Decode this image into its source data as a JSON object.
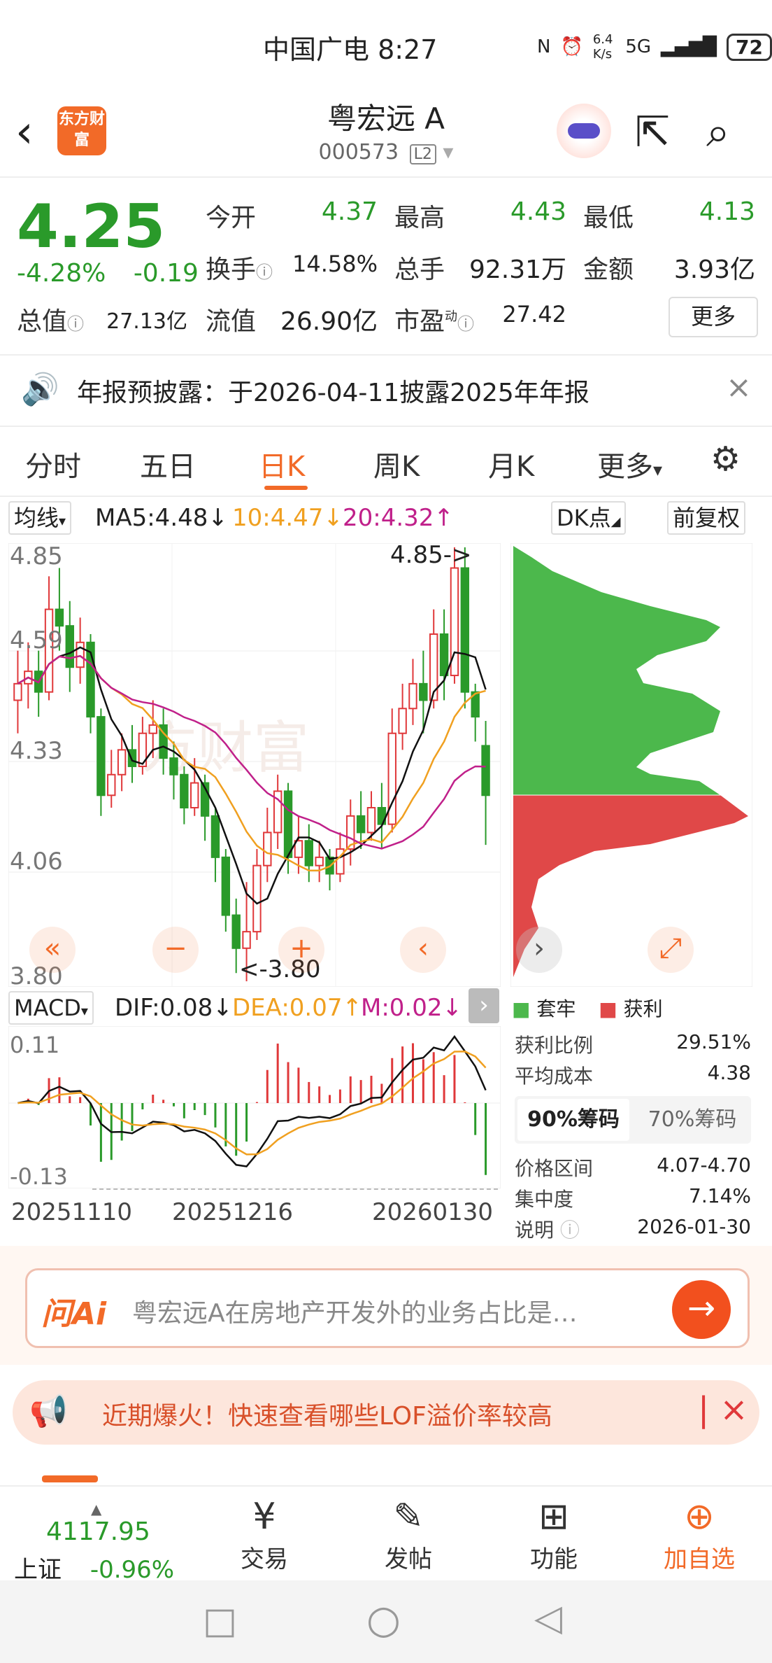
{
  "status_bar": {
    "carrier_time": "中国广电 8:27",
    "net_speed": "6.4 K/s",
    "signal": "5G",
    "battery": "72"
  },
  "header": {
    "logo_text": "东方财富",
    "stock_name": "粤宏远 A",
    "stock_code": "000573",
    "level_badge": "L2"
  },
  "quote": {
    "price": "4.25",
    "change_pct": "-4.28%",
    "change_amt": "-0.19",
    "open_label": "今开",
    "open": "4.37",
    "high_label": "最高",
    "high": "4.43",
    "low_label": "最低",
    "low": "4.13",
    "turnover_label": "换手",
    "turnover": "14.58%",
    "volume_label": "总手",
    "volume": "92.31万",
    "amount_label": "金额",
    "amount": "3.93亿",
    "total_cap_label": "总值",
    "total_cap": "27.13亿",
    "float_cap_label": "流值",
    "float_cap": "26.90亿",
    "pe_label": "市盈",
    "pe_sup": "动",
    "pe": "27.42",
    "more_label": "更多"
  },
  "notice": {
    "text": "年报预披露：于2026-04-11披露2025年年报"
  },
  "tabs": [
    "分时",
    "五日",
    "日K",
    "周K",
    "月K",
    "更多"
  ],
  "ma_row": {
    "selector": "均线",
    "ma5": "MA5:4.48↓",
    "ma10": "10:4.47↓",
    "ma20": "20:4.32↑",
    "dk": "DK点",
    "adjust": "前复权"
  },
  "kchart": {
    "y_labels": [
      "4.85",
      "4.59",
      "4.33",
      "4.06",
      "3.80"
    ],
    "max_marker": "4.85->",
    "min_marker": "<-3.80"
  },
  "macd_row": {
    "selector": "MACD",
    "dif": "DIF:0.08↓",
    "dea": "DEA:0.07↑",
    "m": "M:0.02↓",
    "y_top": "0.11",
    "y_bottom": "-0.13"
  },
  "x_labels": [
    "20251110",
    "20251216",
    "20260130"
  ],
  "chip": {
    "legend_trapped": "套牢",
    "legend_profit": "获利",
    "rows": [
      {
        "label": "获利比例",
        "value": "29.51%"
      },
      {
        "label": "平均成本",
        "value": "4.38"
      }
    ],
    "tab_90": "90%筹码",
    "tab_70": "70%筹码",
    "rows2": [
      {
        "label": "价格区间",
        "value": "4.07-4.70"
      },
      {
        "label": "集中度",
        "value": "7.14%"
      },
      {
        "label": "说明",
        "value": "2026-01-30"
      }
    ]
  },
  "ai": {
    "badge": "问Ai",
    "placeholder": "粤宏远A在房地产开发外的业务占比是…"
  },
  "promo": {
    "text": "近期爆火！快速查看哪些LOF溢价率较高"
  },
  "bottom_nav": {
    "index_value": "4117.95",
    "index_name": "上证",
    "index_change": "-0.96%",
    "items": [
      "交易",
      "发帖",
      "功能",
      "加自选"
    ]
  },
  "colors": {
    "accent": "#f26a28",
    "up": "#e0383a",
    "down": "#2a9a2a",
    "ma10": "#f0a020",
    "ma20": "#c0208a"
  },
  "chart_data": {
    "type": "candlestick",
    "y_range": [
      3.8,
      4.85
    ],
    "candles": [
      {
        "o": 4.48,
        "c": 4.52,
        "h": 4.6,
        "l": 4.4
      },
      {
        "o": 4.52,
        "c": 4.55,
        "h": 4.62,
        "l": 4.46
      },
      {
        "o": 4.55,
        "c": 4.5,
        "h": 4.6,
        "l": 4.44
      },
      {
        "o": 4.5,
        "c": 4.7,
        "h": 4.78,
        "l": 4.48
      },
      {
        "o": 4.7,
        "c": 4.66,
        "h": 4.8,
        "l": 4.6
      },
      {
        "o": 4.66,
        "c": 4.56,
        "h": 4.72,
        "l": 4.5
      },
      {
        "o": 4.56,
        "c": 4.62,
        "h": 4.68,
        "l": 4.52
      },
      {
        "o": 4.62,
        "c": 4.44,
        "h": 4.64,
        "l": 4.4
      },
      {
        "o": 4.44,
        "c": 4.25,
        "h": 4.46,
        "l": 4.2
      },
      {
        "o": 4.25,
        "c": 4.3,
        "h": 4.36,
        "l": 4.22
      },
      {
        "o": 4.3,
        "c": 4.36,
        "h": 4.4,
        "l": 4.26
      },
      {
        "o": 4.36,
        "c": 4.32,
        "h": 4.42,
        "l": 4.28
      },
      {
        "o": 4.32,
        "c": 4.4,
        "h": 4.44,
        "l": 4.3
      },
      {
        "o": 4.4,
        "c": 4.42,
        "h": 4.48,
        "l": 4.34
      },
      {
        "o": 4.42,
        "c": 4.34,
        "h": 4.46,
        "l": 4.3
      },
      {
        "o": 4.34,
        "c": 4.3,
        "h": 4.38,
        "l": 4.24
      },
      {
        "o": 4.3,
        "c": 4.22,
        "h": 4.32,
        "l": 4.18
      },
      {
        "o": 4.22,
        "c": 4.28,
        "h": 4.34,
        "l": 4.2
      },
      {
        "o": 4.28,
        "c": 4.2,
        "h": 4.3,
        "l": 4.14
      },
      {
        "o": 4.2,
        "c": 4.1,
        "h": 4.22,
        "l": 4.04
      },
      {
        "o": 4.1,
        "c": 3.96,
        "h": 4.12,
        "l": 3.92
      },
      {
        "o": 3.96,
        "c": 3.88,
        "h": 4.0,
        "l": 3.82
      },
      {
        "o": 3.88,
        "c": 3.92,
        "h": 4.04,
        "l": 3.8
      },
      {
        "o": 3.92,
        "c": 4.08,
        "h": 4.12,
        "l": 3.9
      },
      {
        "o": 4.08,
        "c": 4.16,
        "h": 4.22,
        "l": 4.04
      },
      {
        "o": 4.16,
        "c": 4.26,
        "h": 4.3,
        "l": 4.12
      },
      {
        "o": 4.26,
        "c": 4.1,
        "h": 4.28,
        "l": 4.06
      },
      {
        "o": 4.1,
        "c": 4.14,
        "h": 4.2,
        "l": 4.06
      },
      {
        "o": 4.14,
        "c": 4.08,
        "h": 4.18,
        "l": 4.04
      },
      {
        "o": 4.08,
        "c": 4.1,
        "h": 4.14,
        "l": 4.04
      },
      {
        "o": 4.1,
        "c": 4.06,
        "h": 4.12,
        "l": 4.02
      },
      {
        "o": 4.06,
        "c": 4.12,
        "h": 4.16,
        "l": 4.04
      },
      {
        "o": 4.12,
        "c": 4.2,
        "h": 4.24,
        "l": 4.08
      },
      {
        "o": 4.2,
        "c": 4.16,
        "h": 4.26,
        "l": 4.12
      },
      {
        "o": 4.16,
        "c": 4.22,
        "h": 4.26,
        "l": 4.14
      },
      {
        "o": 4.22,
        "c": 4.18,
        "h": 4.28,
        "l": 4.12
      },
      {
        "o": 4.18,
        "c": 4.4,
        "h": 4.46,
        "l": 4.16
      },
      {
        "o": 4.4,
        "c": 4.46,
        "h": 4.52,
        "l": 4.36
      },
      {
        "o": 4.46,
        "c": 4.52,
        "h": 4.58,
        "l": 4.42
      },
      {
        "o": 4.52,
        "c": 4.48,
        "h": 4.6,
        "l": 4.4
      },
      {
        "o": 4.48,
        "c": 4.64,
        "h": 4.7,
        "l": 4.46
      },
      {
        "o": 4.64,
        "c": 4.54,
        "h": 4.7,
        "l": 4.48
      },
      {
        "o": 4.54,
        "c": 4.8,
        "h": 4.85,
        "l": 4.52
      },
      {
        "o": 4.8,
        "c": 4.5,
        "h": 4.85,
        "l": 4.46
      },
      {
        "o": 4.5,
        "c": 4.44,
        "h": 4.52,
        "l": 4.38
      },
      {
        "o": 4.37,
        "c": 4.25,
        "h": 4.43,
        "l": 4.13
      }
    ]
  }
}
